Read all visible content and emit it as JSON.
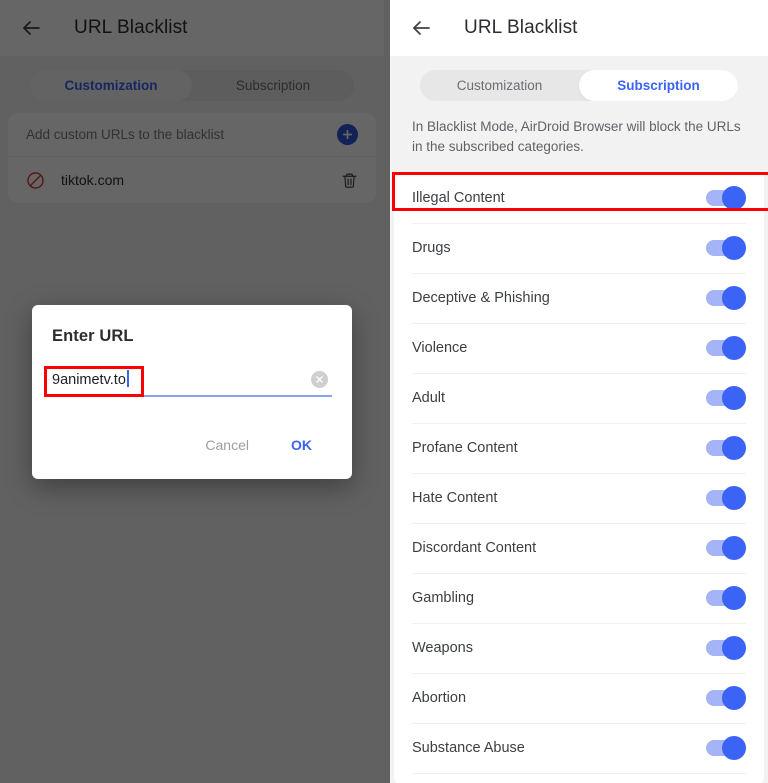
{
  "left_panel": {
    "header": {
      "back_icon": "arrow-left-icon",
      "title": "URL Blacklist"
    },
    "tabs": [
      {
        "label": "Customization",
        "active": true
      },
      {
        "label": "Subscription",
        "active": false
      }
    ],
    "add_row": {
      "label": "Add custom URLs to the blacklist",
      "button_icon": "plus-icon"
    },
    "url_rows": [
      {
        "icon": "block-icon",
        "url": "tiktok.com",
        "delete_icon": "trash-icon"
      }
    ],
    "dialog": {
      "title": "Enter URL",
      "input_value": "9animetv.to",
      "clear_icon": "close-circle-icon",
      "cancel_label": "Cancel",
      "ok_label": "OK"
    }
  },
  "right_panel": {
    "header": {
      "back_icon": "arrow-left-icon",
      "title": "URL Blacklist"
    },
    "tabs": [
      {
        "label": "Customization",
        "active": false
      },
      {
        "label": "Subscription",
        "active": true
      }
    ],
    "description": "In Blacklist Mode, AirDroid Browser will block the URLs in the subscribed categories.",
    "categories": [
      {
        "label": "Illegal Content",
        "enabled": true
      },
      {
        "label": "Drugs",
        "enabled": true
      },
      {
        "label": "Deceptive & Phishing",
        "enabled": true
      },
      {
        "label": "Violence",
        "enabled": true
      },
      {
        "label": "Adult",
        "enabled": true
      },
      {
        "label": "Profane Content",
        "enabled": true
      },
      {
        "label": "Hate Content",
        "enabled": true
      },
      {
        "label": "Discordant Content",
        "enabled": true
      },
      {
        "label": "Gambling",
        "enabled": true
      },
      {
        "label": "Weapons",
        "enabled": true
      },
      {
        "label": "Abortion",
        "enabled": true
      },
      {
        "label": "Substance Abuse",
        "enabled": true
      }
    ]
  },
  "colors": {
    "accent_blue": "#3b63f6",
    "toggle_track": "#a4b4f7",
    "toggle_knob": "#3b63f6",
    "highlight_red": "#ff0000",
    "plus_blue": "#2f54d8",
    "block_red": "#d93025",
    "scrim": "rgba(0,0,0,0.60)"
  }
}
